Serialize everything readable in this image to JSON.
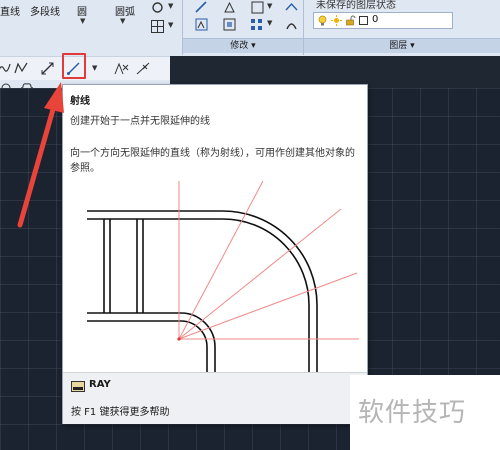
{
  "ribbon": {
    "tools": {
      "line": "直线",
      "polyline": "多段线",
      "circle": "圆",
      "arc": "圆弧"
    },
    "panels": {
      "modify": "修改",
      "layers": "图层"
    },
    "layer_state_text": "未保存的图层状态",
    "layer_current": "0"
  },
  "tooltip": {
    "title": "射线",
    "subtitle": "创建开始于一点并无限延伸的线",
    "description": "向一个方向无限延伸的直线（称为射线），可用作创建其他对象的参照。",
    "command": "RAY",
    "help": "按 F1 键获得更多帮助"
  },
  "watermark": "软件技巧",
  "colors": {
    "highlight": "#e03a3a",
    "ray_lines": "#f08a8a",
    "canvas": "#1c2330"
  }
}
